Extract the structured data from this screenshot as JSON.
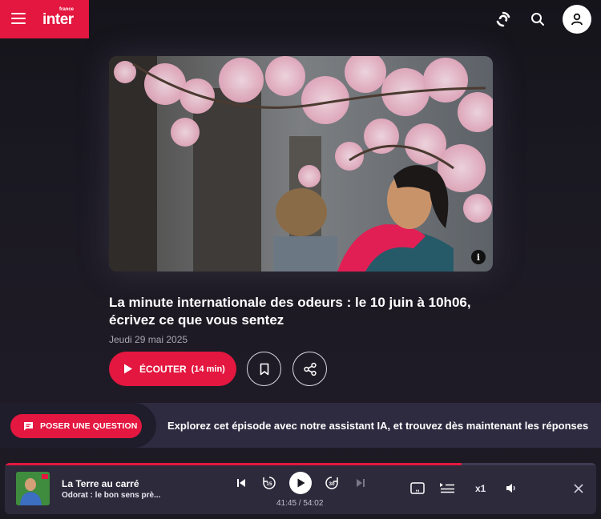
{
  "colors": {
    "brand": "#e3173f",
    "background": "#1b1a23",
    "player_bg": "#2c2a3b",
    "banner_bg": "#2e2b40"
  },
  "header": {
    "logo_text": "inter",
    "logo_superscript": "france",
    "icons": [
      "menu-icon",
      "live-radio-icon",
      "search-icon",
      "user-icon"
    ]
  },
  "episode": {
    "title": "La minute internationale des odeurs : le 10 juin à 10h06, écrivez ce que vous sentez",
    "date": "Jeudi 29 mai 2025",
    "listen_label": "ÉCOUTER",
    "listen_duration": "(14 min)",
    "image_info_label": "i"
  },
  "ai_banner": {
    "button_label": "POSER UNE QUESTION",
    "text": "Explorez cet épisode avec notre assistant IA, et trouvez dès maintenant les réponses"
  },
  "player": {
    "show_title": "La Terre au carré",
    "episode_title": "Odorat : le bon sens prè...",
    "elapsed": "41:45",
    "total": "54:02",
    "time_display": "41:45 / 54:02",
    "progress_fraction": 0.7727,
    "rewind_seconds": "15",
    "forward_seconds": "30",
    "speed": "x1",
    "thumb_label": "TERRE AU CARRÉ"
  }
}
